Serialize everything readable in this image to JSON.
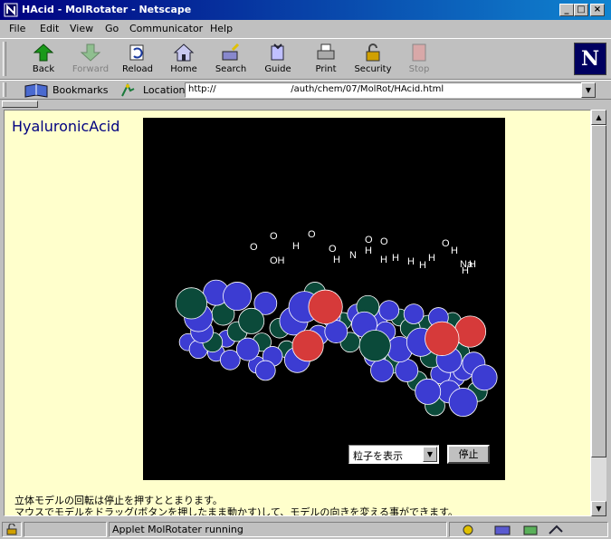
{
  "window": {
    "title": "HAcid - MolRotater - Netscape"
  },
  "menu": [
    "File",
    "Edit",
    "View",
    "Go",
    "Communicator",
    "Help"
  ],
  "toolbar": [
    {
      "label": "Back",
      "icon": "back-arrow-icon",
      "enabled": true
    },
    {
      "label": "Forward",
      "icon": "forward-arrow-icon",
      "enabled": false
    },
    {
      "label": "Reload",
      "icon": "reload-icon",
      "enabled": true
    },
    {
      "label": "Home",
      "icon": "home-icon",
      "enabled": true
    },
    {
      "label": "Search",
      "icon": "search-icon",
      "enabled": true
    },
    {
      "label": "Guide",
      "icon": "guide-icon",
      "enabled": true
    },
    {
      "label": "Print",
      "icon": "printer-icon",
      "enabled": true
    },
    {
      "label": "Security",
      "icon": "lock-icon",
      "enabled": true
    },
    {
      "label": "Stop",
      "icon": "stop-icon",
      "enabled": false
    }
  ],
  "location_bar": {
    "bookmarks_label": "Bookmarks",
    "location_label": "Location:",
    "url": "http://                          /auth/chem/07/MolRot/HAcid.html"
  },
  "page": {
    "heading": "HyaluronicAcid",
    "applet": {
      "display_select": "粒子を表示",
      "stop_button": "停止",
      "atom_labels": [
        "O",
        "O",
        "OH",
        "H",
        "O",
        "O",
        "H",
        "N",
        "H",
        "H",
        "O",
        "O",
        "H",
        "H",
        "H",
        "H",
        "O",
        "H",
        "Na",
        "H",
        "H"
      ],
      "colors": {
        "background": "#000000",
        "oxygen": "#d63a3a",
        "carbon": "#0b4a3a",
        "hydrogen": "#3c3cd2"
      }
    },
    "description": [
      "立体モデルの回転は停止を押すととまります。",
      "マウスでモデルをドラッグ(ボタンを押したまま動かす)して、モデルの向きを変える事ができます。"
    ]
  },
  "status": {
    "text": "Applet MolRotater running"
  }
}
